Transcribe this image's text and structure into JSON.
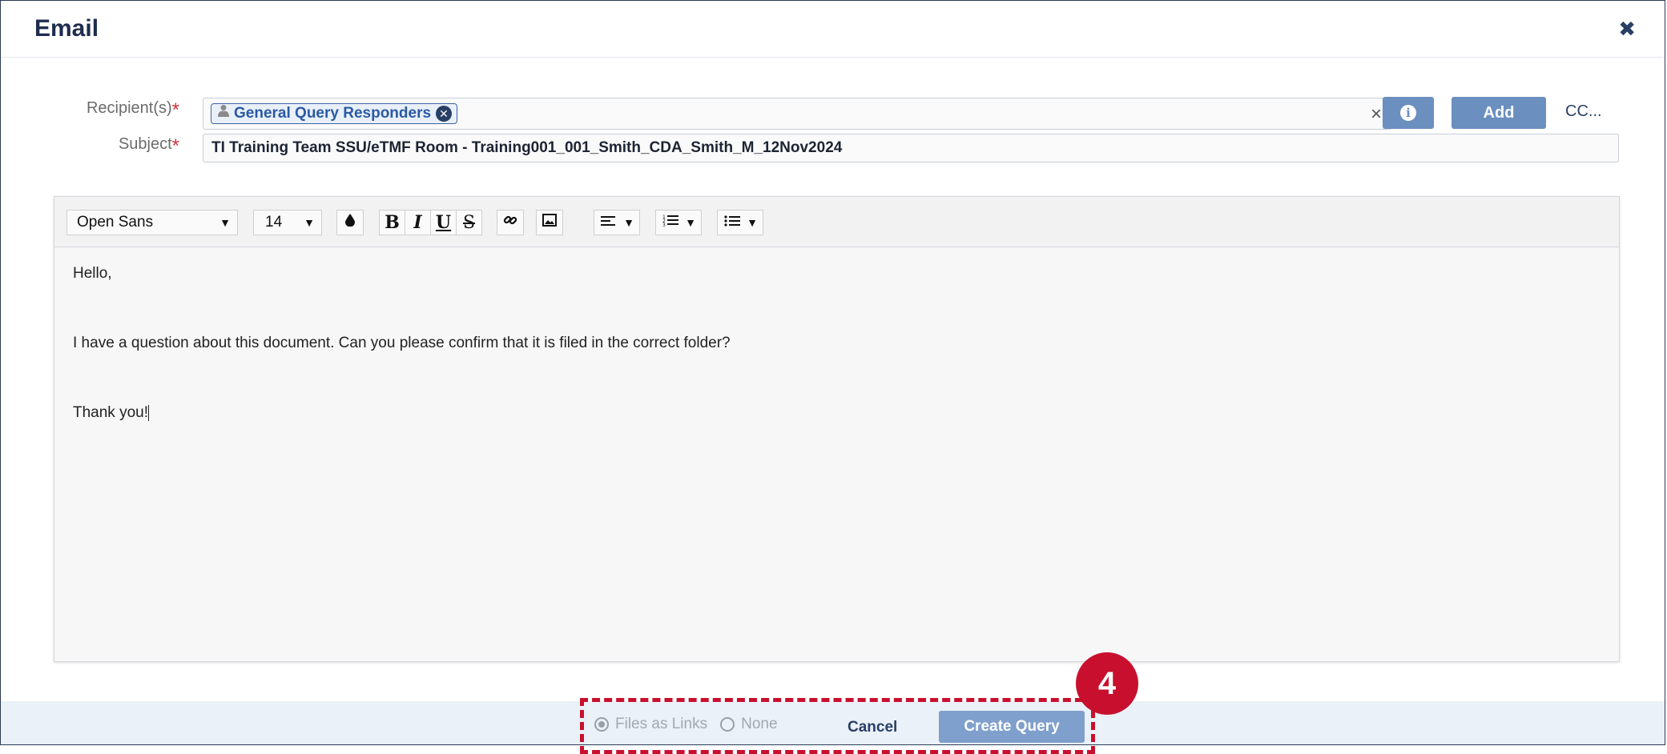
{
  "dialog": {
    "title": "Email",
    "close_icon": "✖"
  },
  "form": {
    "recipients": {
      "label": "Recipient(s)",
      "required_mark": "*",
      "chips": [
        {
          "label": "General Query Responders",
          "icon": "user-icon"
        }
      ],
      "remove_glyph": "✕",
      "clear_glyph": "×"
    },
    "subject": {
      "label": "Subject",
      "required_mark": "*",
      "value": "TI Training Team SSU/eTMF Room - Training001_001_Smith_CDA_Smith_M_12Nov2024"
    },
    "buttons": {
      "info_glyph": "i",
      "add_label": "Add",
      "cc_label": "CC..."
    }
  },
  "editor": {
    "toolbar": {
      "font_family": "Open Sans",
      "font_size": "14",
      "bold": "B",
      "italic": "I",
      "underline": "U",
      "strikethrough": "S"
    },
    "body": {
      "line1": "Hello,",
      "line2": "I have a question about this document. Can you please confirm that it is filed in the correct folder?",
      "line3": "Thank you!"
    }
  },
  "footer": {
    "radio_options": [
      {
        "label": "Files as Links",
        "selected": true
      },
      {
        "label": "None",
        "selected": false
      }
    ],
    "cancel_label": "Cancel",
    "create_label": "Create Query"
  },
  "annotation": {
    "step_number": "4",
    "color": "#c8102e"
  }
}
